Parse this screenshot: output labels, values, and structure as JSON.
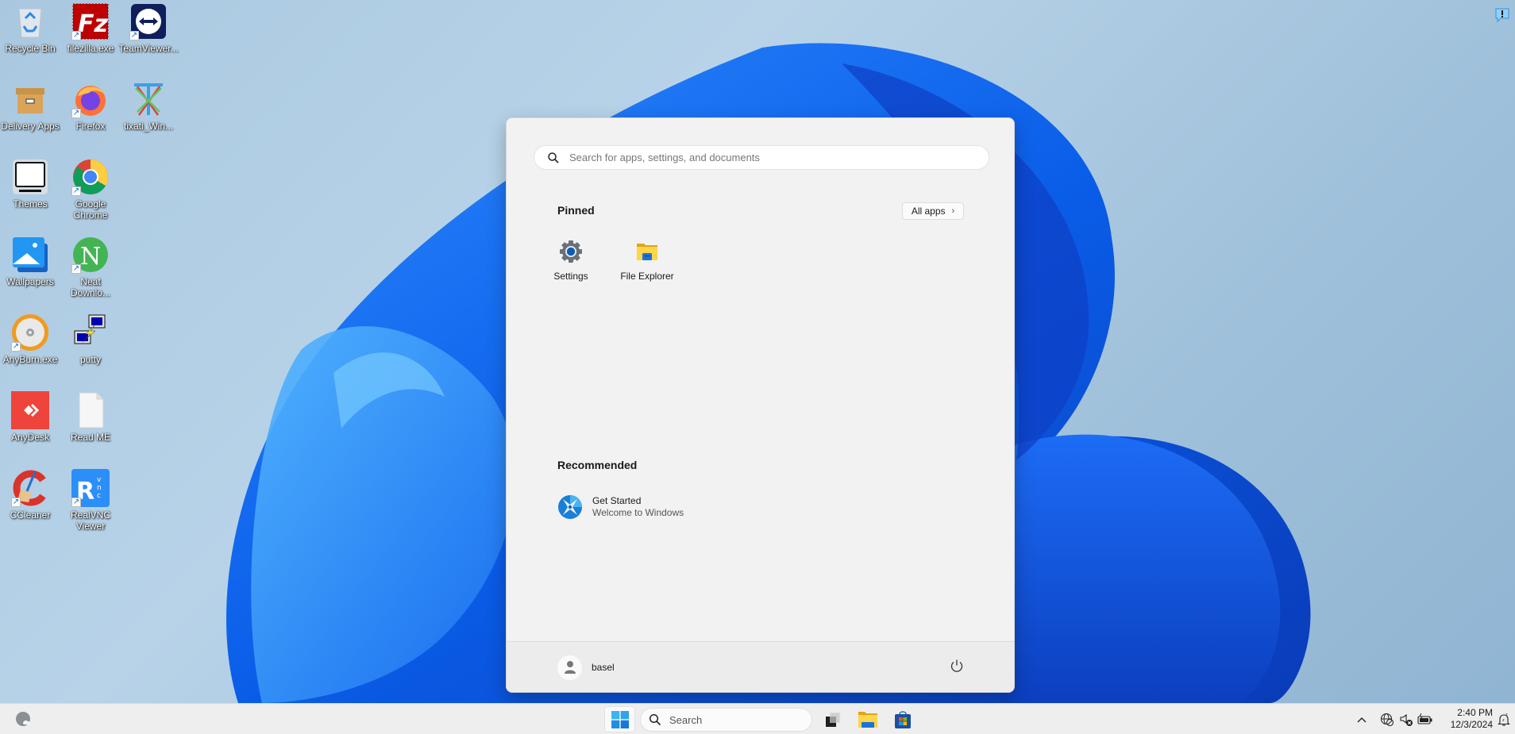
{
  "desktop": {
    "icons": [
      {
        "id": "recycle-bin",
        "label": "Recycle Bin",
        "shortcut": false
      },
      {
        "id": "filezilla",
        "label": "filezilla.exe",
        "shortcut": true
      },
      {
        "id": "teamviewer",
        "label": "TeamViewer...",
        "shortcut": true
      },
      {
        "id": "delivery-apps",
        "label": "Delivery Apps",
        "shortcut": false
      },
      {
        "id": "firefox",
        "label": "Firefox",
        "shortcut": true
      },
      {
        "id": "tixati",
        "label": "tixati_Win...",
        "shortcut": false
      },
      {
        "id": "themes",
        "label": "Themes",
        "shortcut": false
      },
      {
        "id": "chrome",
        "label": "Google Chrome",
        "shortcut": true
      },
      {
        "id": "wallpapers",
        "label": "Wallpapers",
        "shortcut": false
      },
      {
        "id": "neat-download",
        "label": "Neat Downlo...",
        "shortcut": true
      },
      {
        "id": "anyburn",
        "label": "AnyBurn.exe",
        "shortcut": true
      },
      {
        "id": "putty",
        "label": "putty",
        "shortcut": false
      },
      {
        "id": "anydesk",
        "label": "AnyDesk",
        "shortcut": false
      },
      {
        "id": "readme",
        "label": "Read ME",
        "shortcut": false
      },
      {
        "id": "ccleaner",
        "label": "CCleaner",
        "shortcut": true
      },
      {
        "id": "realvnc",
        "label": "RealVNC Viewer",
        "shortcut": true
      }
    ]
  },
  "start_menu": {
    "search_placeholder": "Search for apps, settings, and documents",
    "search_value": "",
    "pinned_title": "Pinned",
    "all_apps_label": "All apps",
    "pinned": [
      {
        "label": "Settings",
        "icon": "settings-gear-icon"
      },
      {
        "label": "File Explorer",
        "icon": "folder-icon"
      }
    ],
    "recommended_title": "Recommended",
    "recommended": [
      {
        "title": "Get Started",
        "subtitle": "Welcome to Windows",
        "icon": "get-started-icon"
      }
    ],
    "user_name": "basel",
    "power_icon": "power-icon"
  },
  "taskbar": {
    "search_label": "Search",
    "apps": [
      "task-view",
      "file-explorer",
      "microsoft-store"
    ],
    "tray": {
      "time": "2:40 PM",
      "date": "12/3/2024",
      "icons": [
        "chevron-up",
        "network-disconnected",
        "volume-muted",
        "battery-charging",
        "notifications-dnd"
      ]
    }
  },
  "colors": {
    "accent": "#0078d4",
    "start_bg": "#f2f2f2",
    "taskbar_bg": "#eeeeee"
  }
}
